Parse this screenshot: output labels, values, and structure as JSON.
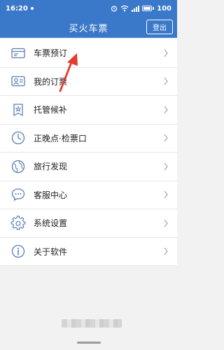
{
  "status_bar": {
    "time": "16:20",
    "battery_percent": "100",
    "icons": [
      "alarm-icon",
      "wifi-icon",
      "signal-icon",
      "battery-icon"
    ]
  },
  "header": {
    "title": "买火车票",
    "logout_label": "登出"
  },
  "menu": {
    "items": [
      {
        "label": "车票预订",
        "icon": "ticket-card-icon"
      },
      {
        "label": "我的订票",
        "icon": "user-card-icon"
      },
      {
        "label": "托管候补",
        "icon": "bookmark-star-icon"
      },
      {
        "label": "正晚点·检票口",
        "icon": "clock-icon"
      },
      {
        "label": "旅行发现",
        "icon": "globe-icon"
      },
      {
        "label": "客服中心",
        "icon": "chat-bubble-icon"
      },
      {
        "label": "系统设置",
        "icon": "gear-icon"
      },
      {
        "label": "关于软件",
        "icon": "info-icon"
      }
    ]
  },
  "colors": {
    "header_blue": "#3a78c9",
    "icon_blue": "#5b7fb5",
    "annotation_red": "#e53a2f"
  }
}
